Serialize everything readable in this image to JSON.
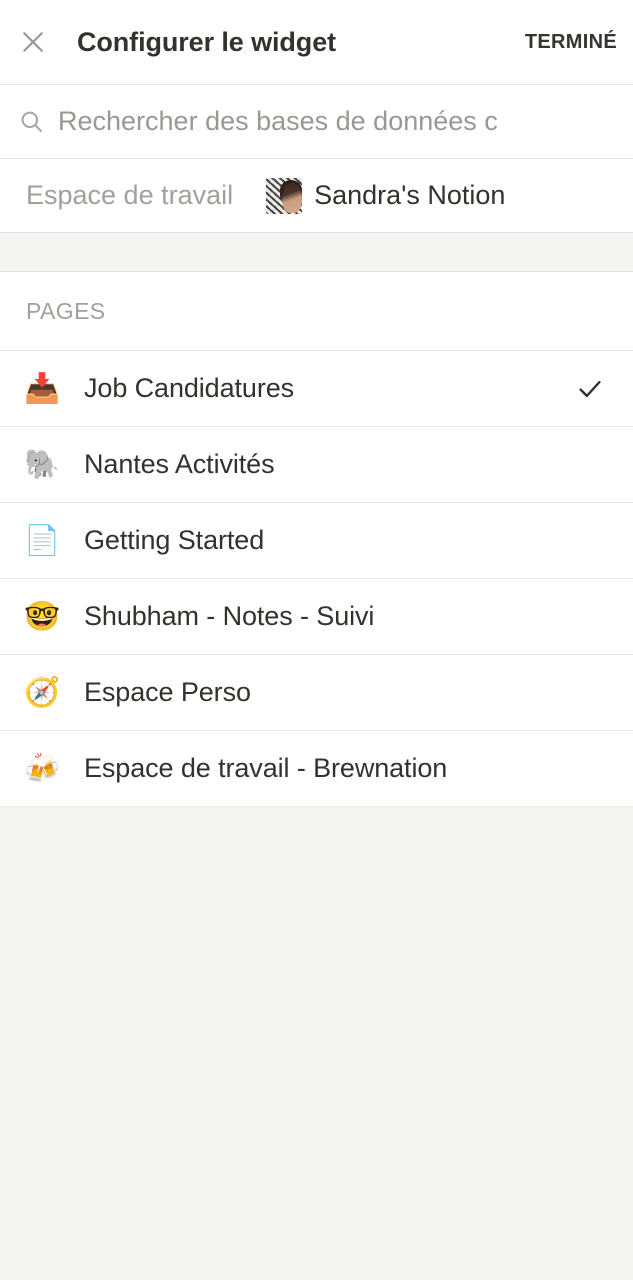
{
  "header": {
    "title": "Configurer le widget",
    "close_icon": "close-icon",
    "done_label": "TERMINÉ"
  },
  "search": {
    "icon": "search-icon",
    "placeholder": "Rechercher des bases de données c",
    "value": ""
  },
  "workspace": {
    "label": "Espace de travail",
    "avatar_icon": "avatar",
    "value": "Sandra's Notion"
  },
  "section": {
    "label": "PAGES"
  },
  "pages": [
    {
      "emoji": "📥",
      "icon_name": "inbox-tray-emoji",
      "label": "Job Candidatures",
      "selected": true
    },
    {
      "emoji": "🐘",
      "icon_name": "elephant-emoji",
      "label": "Nantes Activités",
      "selected": false
    },
    {
      "emoji": "📄",
      "icon_name": "page-facing-up-emoji",
      "label": "Getting Started",
      "selected": false
    },
    {
      "emoji": "🤓",
      "icon_name": "nerd-face-emoji",
      "label": "Shubham - Notes - Suivi",
      "selected": false
    },
    {
      "emoji": "🧭",
      "icon_name": "compass-emoji",
      "label": "Espace Perso",
      "selected": false
    },
    {
      "emoji": "🍻",
      "icon_name": "clinking-beer-mugs-emoji",
      "label": "Espace de travail - Brewnation",
      "selected": false
    }
  ],
  "colors": {
    "page_background": "#f4f3f0",
    "surface": "#ffffff",
    "text_primary": "#35312c",
    "text_muted": "#a2a09b",
    "divider": "#eae8e4",
    "check": "#333029"
  }
}
